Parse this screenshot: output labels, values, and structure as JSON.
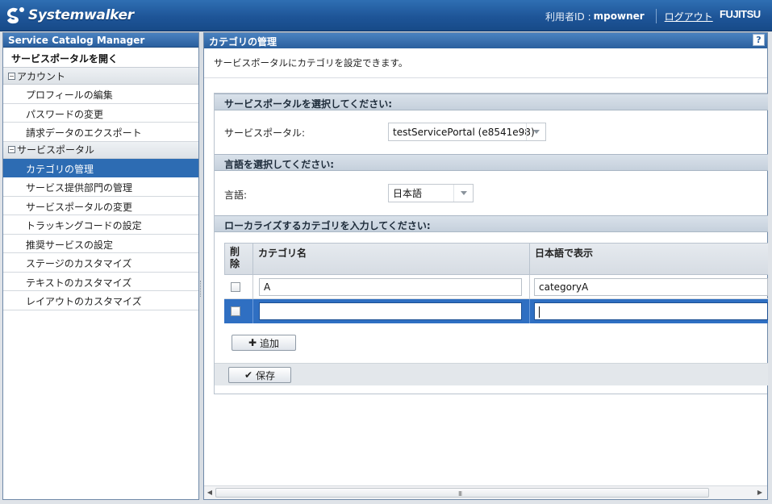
{
  "header": {
    "brand": "Systemwalker",
    "user_label": "利用者ID :",
    "user_name": "mpowner",
    "logout": "ログアウト",
    "vendor": "FUJITSU",
    "colors": {
      "bar": "#1e5598",
      "accent": "#2d6cb3"
    }
  },
  "sidebar": {
    "title": "Service Catalog Manager",
    "open_portal": "サービスポータルを開く",
    "groups": [
      {
        "label": "アカウント",
        "toggle": "−",
        "items": [
          {
            "label": "プロフィールの編集"
          },
          {
            "label": "パスワードの変更"
          },
          {
            "label": "請求データのエクスポート"
          }
        ]
      },
      {
        "label": "サービスポータル",
        "toggle": "−",
        "items": [
          {
            "label": "カテゴリの管理"
          },
          {
            "label": "サービス提供部門の管理"
          },
          {
            "label": "サービスポータルの変更"
          },
          {
            "label": "トラッキングコードの設定"
          },
          {
            "label": "推奨サービスの設定"
          },
          {
            "label": "ステージのカスタマイズ"
          },
          {
            "label": "テキストのカスタマイズ"
          },
          {
            "label": "レイアウトのカスタマイズ"
          }
        ]
      }
    ]
  },
  "main": {
    "title": "カテゴリの管理",
    "help": "?",
    "description": "サービスポータルにカテゴリを設定できます。",
    "sections": {
      "portal": {
        "heading": "サービスポータルを選択してください:",
        "label": "サービスポータル:",
        "value": "testServicePortal (e8541e98)"
      },
      "language": {
        "heading": "言語を選択してください:",
        "label": "言語:",
        "value": "日本語"
      },
      "categories": {
        "heading": "ローカライズするカテゴリを入力してください:",
        "columns": {
          "delete_line1": "削",
          "delete_line2": "除",
          "name": "カテゴリ名",
          "display": "日本語で表示"
        },
        "rows": [
          {
            "name": "A",
            "display": "categoryA",
            "checked": false
          },
          {
            "name": "",
            "display": "",
            "checked": false
          }
        ]
      }
    },
    "add_button": "追加",
    "save_button": "保存",
    "scroll_grip": "III"
  }
}
